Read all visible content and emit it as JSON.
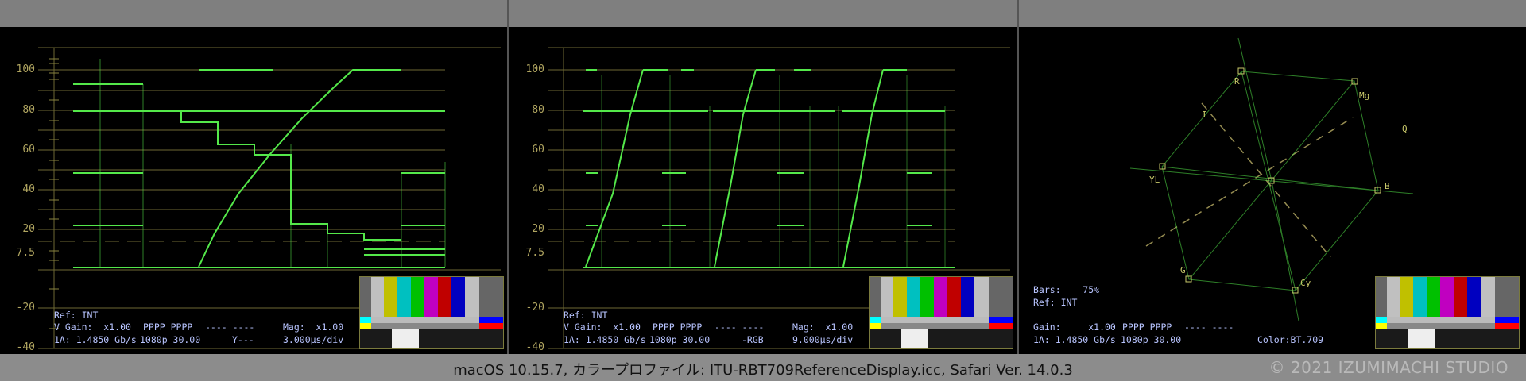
{
  "waveform_scale": {
    "labels": [
      "100",
      "80",
      "60",
      "40",
      "20",
      "7.5",
      "-20",
      "-40"
    ]
  },
  "panel1": {
    "ref": "Ref: INT",
    "v_gain": "V Gain:  x1.00",
    "pppp": "PPPP PPPP",
    "dashes": "---- ----",
    "mag": "Mag:  x1.00",
    "source": "1A: 1.4850 Gb/s",
    "format": "1080p 30.00",
    "mode": "Y---",
    "timebase": "3.000μs/div"
  },
  "panel2": {
    "ref": "Ref: INT",
    "v_gain": "V Gain:  x1.00",
    "pppp": "PPPP PPPP",
    "dashes": "---- ----",
    "mag": "Mag:  x1.00",
    "source": "1A: 1.4850 Gb/s",
    "format": "1080p 30.00",
    "mode": "-RGB",
    "timebase": "9.000μs/div"
  },
  "panel3": {
    "bars": "Bars:    75%",
    "ref": "Ref: INT",
    "gain": "Gain:     x1.00",
    "pppp": "PPPP PPPP",
    "dashes": "---- ----",
    "source": "1A: 1.4850 Gb/s",
    "format": "1080p 30.00",
    "color": "Color:BT.709",
    "vector_labels": {
      "r": "R",
      "mg": "Mg",
      "b": "B",
      "cy": "Cy",
      "g": "G",
      "yl": "YL",
      "i": "I",
      "q": "Q"
    }
  },
  "colors": {
    "trace": "#54e84a",
    "graticule": "#b0a560",
    "info_text": "#b8c4ff",
    "bar_colors": [
      "#c0c0c0",
      "#c0c000",
      "#00c0c0",
      "#00c000",
      "#c000c0",
      "#c00000",
      "#0000c0"
    ]
  },
  "footer": {
    "caption": "macOS 10.15.7, カラープロファイル: ITU-RBT709ReferenceDisplay.icc, Safari Ver. 14.0.3",
    "copyright": "© 2021 IZUMIMACHI STUDIO"
  }
}
